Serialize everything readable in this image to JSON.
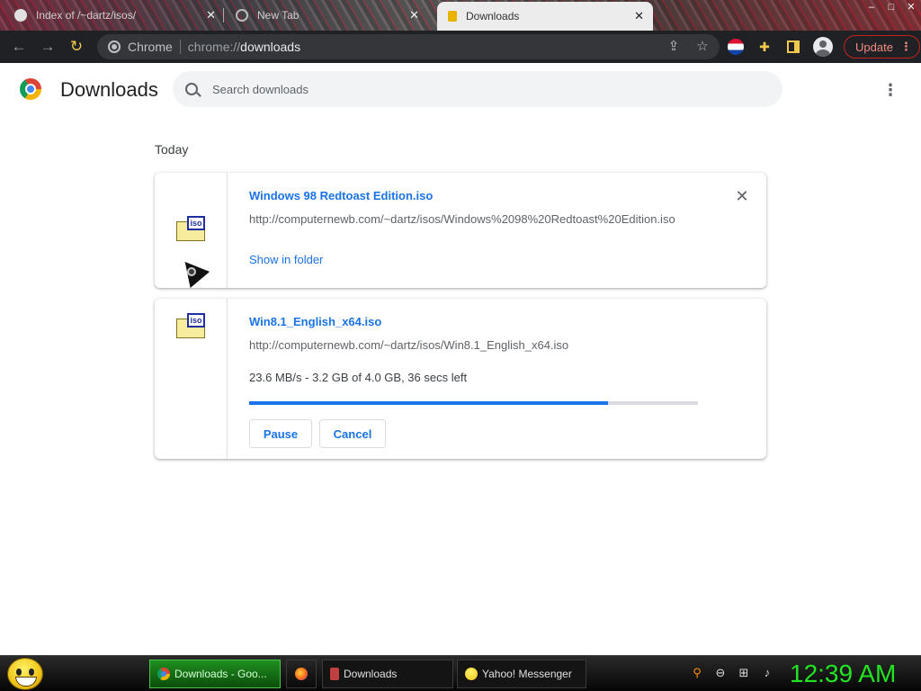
{
  "tabs": [
    {
      "title": "Index of /~dartz/isos/",
      "close": "✕"
    },
    {
      "title": "New Tab",
      "close": "✕"
    },
    {
      "title": "Downloads",
      "close": "✕",
      "active": true
    }
  ],
  "window_controls": {
    "minimize": "–",
    "maximize": "□",
    "close": "✕"
  },
  "toolbar": {
    "back": "←",
    "forward": "→",
    "reload": "↻",
    "site_label": "Chrome",
    "url_scheme": "chrome://",
    "url_host": "downloads",
    "update_label": "Update"
  },
  "page": {
    "title": "Downloads",
    "search_placeholder": "Search downloads",
    "section": "Today"
  },
  "downloads": [
    {
      "file_name": "Windows 98 Redtoast Edition.iso",
      "url": "http://computernewb.com/~dartz/isos/Windows%2098%20Redtoast%20Edition.iso",
      "action": "Show in folder",
      "icon_text": "iso"
    },
    {
      "file_name": "Win8.1_English_x64.iso",
      "url": "http://computernewb.com/~dartz/isos/Win8.1_English_x64.iso",
      "status": "23.6 MB/s - 3.2 GB of 4.0 GB, 36 secs left",
      "progress_fraction": 0.8,
      "pause_label": "Pause",
      "cancel_label": "Cancel",
      "icon_text": "iso"
    }
  ],
  "taskbar": {
    "tasks": [
      {
        "label": "Downloads - Goo..."
      },
      {
        "label": "Downloads"
      },
      {
        "label": "Yahoo! Messenger"
      }
    ],
    "clock": "12:39 AM"
  },
  "colors": {
    "accent": "#1a73e8",
    "toolbar_bg": "#202124",
    "update_red": "#c5221f",
    "clock_green": "#22e322"
  }
}
